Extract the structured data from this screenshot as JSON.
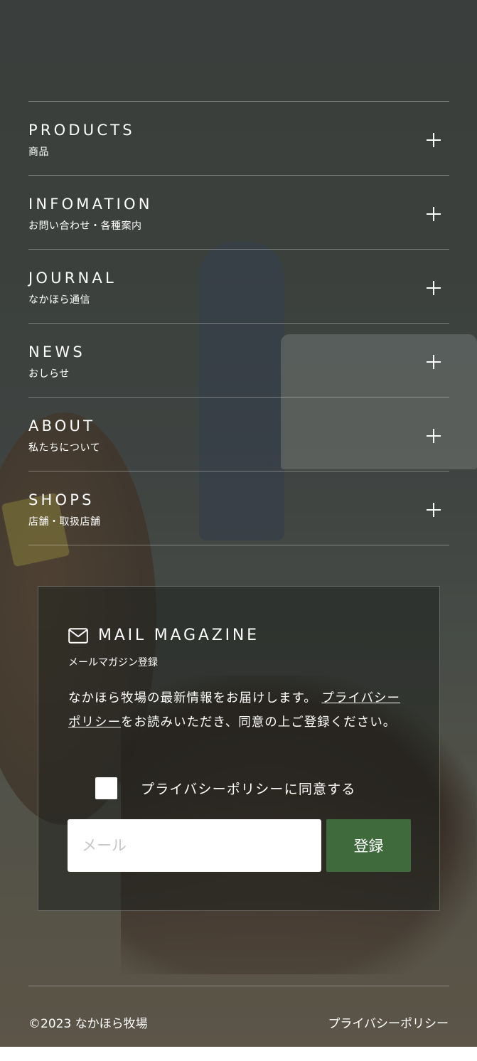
{
  "menu": [
    {
      "en": "PRODUCTS",
      "jp": "商品"
    },
    {
      "en": "INFOMATION",
      "jp": "お問い合わせ・各種案内"
    },
    {
      "en": "JOURNAL",
      "jp": "なかほら通信"
    },
    {
      "en": "NEWS",
      "jp": "おしらせ"
    },
    {
      "en": "ABOUT",
      "jp": "私たちについて"
    },
    {
      "en": "SHOPS",
      "jp": "店舗・取扱店舗"
    }
  ],
  "magazine": {
    "title": "MAIL MAGAZINE",
    "subtitle": "メールマガジン登録",
    "desc_before": "なかほら牧場の最新情報をお届けします。",
    "desc_link": "プライバシーポリシー",
    "desc_after": "をお読みいただき、同意の上ご登録ください。",
    "agree_label": "プライバシーポリシーに同意する",
    "email_placeholder": "メール",
    "submit_label": "登録"
  },
  "footer": {
    "copyright": "©2023 なかほら牧場",
    "policy_link": "プライバシーポリシー"
  },
  "icons": {
    "expand": "plus-icon",
    "mail": "mail-icon"
  }
}
